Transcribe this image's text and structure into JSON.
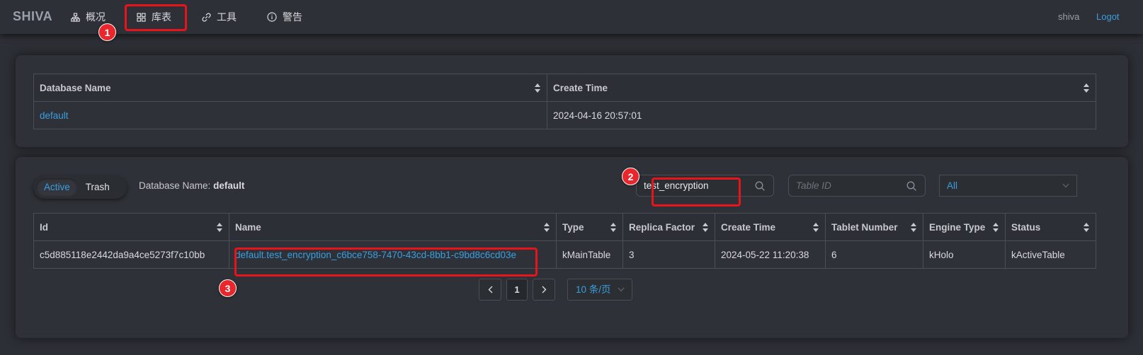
{
  "app": {
    "brand": "SHIVA"
  },
  "nav": {
    "items": [
      {
        "label": "概况",
        "icon": "sitemap-icon"
      },
      {
        "label": "库表",
        "icon": "grid-icon"
      },
      {
        "label": "工具",
        "icon": "link-icon"
      },
      {
        "label": "警告",
        "icon": "info-icon"
      }
    ],
    "user": "shiva",
    "logout": "Logot"
  },
  "databases": {
    "columns": [
      "Database Name",
      "Create Time"
    ],
    "rows": [
      {
        "name": "default",
        "create_time": "2024-04-16 20:57:01"
      }
    ]
  },
  "tables_panel": {
    "segments": {
      "active": "Active",
      "trash": "Trash",
      "selected": "Active"
    },
    "db_label_prefix": "Database Name:",
    "db_label_value": "default",
    "name_search": {
      "value": "test_encryption",
      "placeholder": ""
    },
    "id_search": {
      "value": "",
      "placeholder": "Table ID"
    },
    "status_filter": "All",
    "columns": [
      "Id",
      "Name",
      "Type",
      "Replica Factor",
      "Create Time",
      "Tablet Number",
      "Engine Type",
      "Status"
    ],
    "rows": [
      {
        "id": "c5d885118e2442da9a4ce5273f7c10bb",
        "name": "default.test_encryption_c6bce758-7470-43cd-8bb1-c9bd8c6cd03e",
        "type": "kMainTable",
        "replica_factor": "3",
        "create_time": "2024-05-22 11:20:38",
        "tablet_number": "6",
        "engine_type": "kHolo",
        "status": "kActiveTable"
      }
    ],
    "pagination": {
      "prev": "<",
      "current": "1",
      "next": ">",
      "page_size": "10 条/页"
    }
  },
  "annotations": [
    "1",
    "2",
    "3"
  ],
  "colors": {
    "accent": "#3b9ede",
    "highlight": "#e8141c",
    "background": "#2c2f35"
  }
}
